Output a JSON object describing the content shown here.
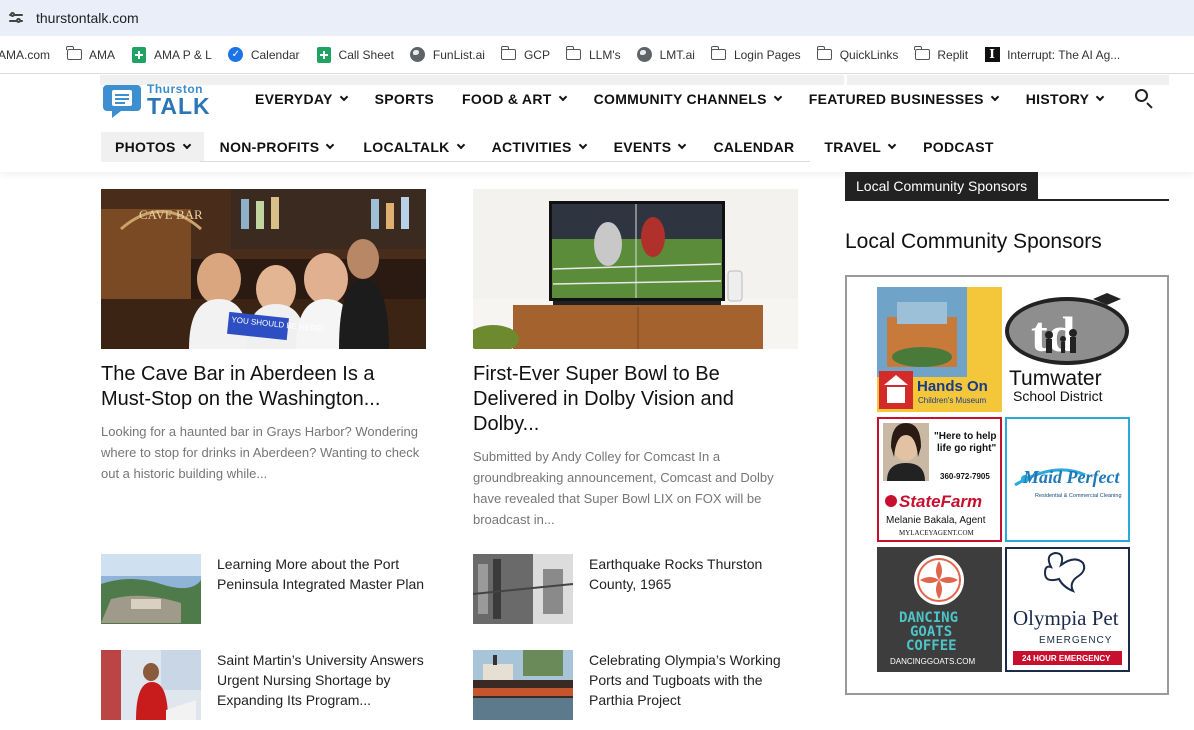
{
  "browser": {
    "url": "thurstontalk.com",
    "bookmarks": [
      {
        "label": "AMA.com",
        "icon": "none"
      },
      {
        "label": "AMA",
        "icon": "folder-icon"
      },
      {
        "label": "AMA P & L",
        "icon": "sheets-icon"
      },
      {
        "label": "Calendar",
        "icon": "calendar-icon"
      },
      {
        "label": "Call Sheet",
        "icon": "sheets-icon"
      },
      {
        "label": "FunList.ai",
        "icon": "globe-icon"
      },
      {
        "label": "GCP",
        "icon": "folder-icon"
      },
      {
        "label": "LLM's",
        "icon": "folder-icon"
      },
      {
        "label": "LMT.ai",
        "icon": "globe-icon"
      },
      {
        "label": "Login Pages",
        "icon": "folder-icon"
      },
      {
        "label": "QuickLinks",
        "icon": "folder-icon"
      },
      {
        "label": "Replit",
        "icon": "folder-icon"
      },
      {
        "label": "Interrupt: The AI Ag...",
        "icon": "interrupt-icon"
      }
    ]
  },
  "site": {
    "logo_top": "Thurston",
    "logo_bottom": "TALK",
    "nav_primary": [
      {
        "label": "EVERYDAY",
        "dropdown": true
      },
      {
        "label": "SPORTS",
        "dropdown": false
      },
      {
        "label": "FOOD & ART",
        "dropdown": true
      },
      {
        "label": "COMMUNITY CHANNELS",
        "dropdown": true
      },
      {
        "label": "FEATURED BUSINESSES",
        "dropdown": true
      },
      {
        "label": "HISTORY",
        "dropdown": true
      }
    ],
    "nav_secondary": [
      {
        "label": "PHOTOS",
        "dropdown": true,
        "active": true
      },
      {
        "label": "NON-PROFITS",
        "dropdown": true
      },
      {
        "label": "LOCALTALK",
        "dropdown": true
      },
      {
        "label": "ACTIVITIES",
        "dropdown": true
      },
      {
        "label": "EVENTS",
        "dropdown": true
      },
      {
        "label": "CALENDAR",
        "dropdown": false
      },
      {
        "label": "TRAVEL",
        "dropdown": true
      },
      {
        "label": "PODCAST",
        "dropdown": false
      }
    ]
  },
  "featured": [
    {
      "title": "The Cave Bar in Aberdeen Is a Must-Stop on the Washington...",
      "excerpt": "Looking for a haunted bar in Grays Harbor? Wondering where to stop for drinks in Aberdeen? Wanting to check out a historic building while...",
      "image_sign": "YOU SHOULD BE HERE!",
      "image_bar_text": "CAVE BAR"
    },
    {
      "title": "First-Ever Super Bowl to Be Delivered in Dolby Vision and Dolby...",
      "excerpt": "Submitted by Andy Colley for Comcast In a groundbreaking announcement, Comcast and Dolby have revealed that Super Bowl LIX on FOX will be broadcast in..."
    }
  ],
  "small_articles": [
    {
      "title": "Learning More about the Port Peninsula Integrated Master Plan"
    },
    {
      "title": "Earthquake Rocks Thurston County, 1965"
    },
    {
      "title": "Saint Martin’s University Answers Urgent Nursing Shortage by Expanding Its Program..."
    },
    {
      "title": "Celebrating Olympia’s Working Ports and Tugboats with the Parthia Project"
    }
  ],
  "sidebar": {
    "tag": "Local Community Sponsors",
    "title": "Local Community Sponsors",
    "ads": {
      "hands_on": {
        "line1": "Hands On",
        "line2": "Children's Museum"
      },
      "tumwater": {
        "mark": "td",
        "line1": "Tumwater",
        "line2": "School District"
      },
      "statefarm": {
        "quote1": "\"Here to help",
        "quote2": "life go right\"",
        "phone": "360-972-7905",
        "brand": "StateFarm",
        "agent": "Melanie Bakala, Agent",
        "site": "MYLACEYAGENT.COM"
      },
      "maid": {
        "name": "Maid Perfect",
        "tagline": "Residential & Commercial Cleaning"
      },
      "goats": {
        "line1": "DANCING",
        "line2": "GOATS",
        "line3": "COFFEE",
        "site": "DANCINGGOATS.COM"
      },
      "pet": {
        "name": "Olympia Pet",
        "sub": "EMERGENCY",
        "badge": "24 HOUR EMERGENCY"
      }
    }
  }
}
